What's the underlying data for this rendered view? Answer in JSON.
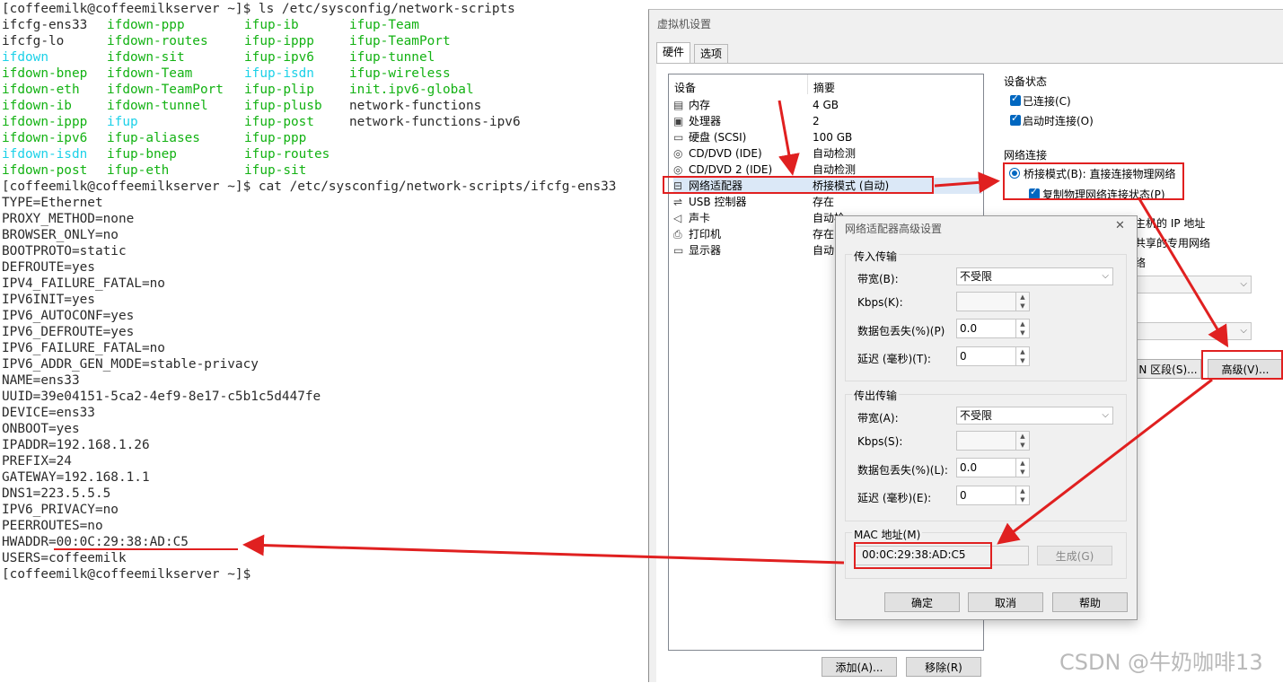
{
  "terminal": {
    "prompt1": "[coffeemilk@coffeemilkserver ~]$ ls /etc/sysconfig/network-scripts",
    "ls_rows": [
      [
        {
          "t": "ifcfg-ens33",
          "c": "norm"
        },
        {
          "t": "ifdown-ppp",
          "c": "green"
        },
        {
          "t": "ifup-ib",
          "c": "green"
        },
        {
          "t": "ifup-Team",
          "c": "green"
        }
      ],
      [
        {
          "t": "ifcfg-lo",
          "c": "norm"
        },
        {
          "t": "ifdown-routes",
          "c": "green"
        },
        {
          "t": "ifup-ippp",
          "c": "green"
        },
        {
          "t": "ifup-TeamPort",
          "c": "green"
        }
      ],
      [
        {
          "t": "ifdown",
          "c": "cyan"
        },
        {
          "t": "ifdown-sit",
          "c": "green"
        },
        {
          "t": "ifup-ipv6",
          "c": "green"
        },
        {
          "t": "ifup-tunnel",
          "c": "green"
        }
      ],
      [
        {
          "t": "ifdown-bnep",
          "c": "green"
        },
        {
          "t": "ifdown-Team",
          "c": "green"
        },
        {
          "t": "ifup-isdn",
          "c": "cyan"
        },
        {
          "t": "ifup-wireless",
          "c": "green"
        }
      ],
      [
        {
          "t": "ifdown-eth",
          "c": "green"
        },
        {
          "t": "ifdown-TeamPort",
          "c": "green"
        },
        {
          "t": "ifup-plip",
          "c": "green"
        },
        {
          "t": "init.ipv6-global",
          "c": "green"
        }
      ],
      [
        {
          "t": "ifdown-ib",
          "c": "green"
        },
        {
          "t": "ifdown-tunnel",
          "c": "green"
        },
        {
          "t": "ifup-plusb",
          "c": "green"
        },
        {
          "t": "network-functions",
          "c": "norm"
        }
      ],
      [
        {
          "t": "ifdown-ippp",
          "c": "green"
        },
        {
          "t": "ifup",
          "c": "cyan"
        },
        {
          "t": "ifup-post",
          "c": "green"
        },
        {
          "t": "network-functions-ipv6",
          "c": "norm"
        }
      ],
      [
        {
          "t": "ifdown-ipv6",
          "c": "green"
        },
        {
          "t": "ifup-aliases",
          "c": "green"
        },
        {
          "t": "ifup-ppp",
          "c": "green"
        },
        {
          "t": "",
          "c": "norm"
        }
      ],
      [
        {
          "t": "ifdown-isdn",
          "c": "cyan"
        },
        {
          "t": "ifup-bnep",
          "c": "green"
        },
        {
          "t": "ifup-routes",
          "c": "green"
        },
        {
          "t": "",
          "c": "norm"
        }
      ],
      [
        {
          "t": "ifdown-post",
          "c": "green"
        },
        {
          "t": "ifup-eth",
          "c": "green"
        },
        {
          "t": "ifup-sit",
          "c": "green"
        },
        {
          "t": "",
          "c": "norm"
        }
      ]
    ],
    "prompt2": "[coffeemilk@coffeemilkserver ~]$ cat /etc/sysconfig/network-scripts/ifcfg-ens33",
    "cfg_lines": [
      "TYPE=Ethernet",
      "PROXY_METHOD=none",
      "BROWSER_ONLY=no",
      "BOOTPROTO=static",
      "DEFROUTE=yes",
      "IPV4_FAILURE_FATAL=no",
      "IPV6INIT=yes",
      "IPV6_AUTOCONF=yes",
      "IPV6_DEFROUTE=yes",
      "IPV6_FAILURE_FATAL=no",
      "IPV6_ADDR_GEN_MODE=stable-privacy",
      "NAME=ens33",
      "UUID=39e04151-5ca2-4ef9-8e17-c5b1c5d447fe",
      "DEVICE=ens33",
      "ONBOOT=yes",
      "IPADDR=192.168.1.26",
      "PREFIX=24",
      "GATEWAY=192.168.1.1",
      "DNS1=223.5.5.5",
      "IPV6_PRIVACY=no",
      "PEERROUTES=no",
      "HWADDR=00:0C:29:38:AD:C5",
      "USERS=coffeemilk"
    ],
    "prompt3": "[coffeemilk@coffeemilkserver ~]$",
    "colors": {
      "green": "#13b213",
      "cyan": "#1cd1e8",
      "text": "#2b2b2b"
    }
  },
  "vm": {
    "title": "虚拟机设置",
    "tabs": [
      "硬件",
      "选项"
    ],
    "col_device": "设备",
    "col_summary": "摘要",
    "devices": [
      {
        "name": "内存",
        "summary": "4 GB",
        "icon": "memory-icon"
      },
      {
        "name": "处理器",
        "summary": "2",
        "icon": "cpu-icon"
      },
      {
        "name": "硬盘 (SCSI)",
        "summary": "100 GB",
        "icon": "harddisk-icon"
      },
      {
        "name": "CD/DVD (IDE)",
        "summary": "自动检测",
        "icon": "cdrom-icon"
      },
      {
        "name": "CD/DVD 2 (IDE)",
        "summary": "自动检测",
        "icon": "cdrom-icon"
      },
      {
        "name": "网络适配器",
        "summary": "桥接模式 (自动)",
        "icon": "network-adapter-icon"
      },
      {
        "name": "USB 控制器",
        "summary": "存在",
        "icon": "usb-icon"
      },
      {
        "name": "声卡",
        "summary": "自动检",
        "icon": "speaker-icon"
      },
      {
        "name": "打印机",
        "summary": "存在",
        "icon": "printer-icon"
      },
      {
        "name": "显示器",
        "summary": "自动",
        "icon": "monitor-icon"
      }
    ],
    "add_button": "添加(A)...",
    "remove_button": "移除(R)",
    "device_status": "设备状态",
    "connected": "已连接(C)",
    "connect_on_power": "启动时连接(O)",
    "net_conn": "网络连接",
    "bridged": "桥接模式(B): 直接连接物理网络",
    "replicate": "复制物理网络连接状态(P)",
    "partial_host_ip": "主机的 IP 地址",
    "partial_shared": "共享的专用网络",
    "partial_grid": "络",
    "lan_segment_btn": "N 区段(S)...",
    "advanced_btn": "高级(V)..."
  },
  "dialog": {
    "title": "网络适配器高级设置",
    "incoming": "传入传输",
    "outgoing": "传出传输",
    "bandwidth_in_label": "带宽(B):",
    "bandwidth_in_value": "不受限",
    "kbps_in_label": "Kbps(K):",
    "loss_in_label": "数据包丢失(%)(P)",
    "loss_in_value": "0.0",
    "delay_in_label": "延迟 (毫秒)(T):",
    "delay_in_value": "0",
    "bandwidth_out_label": "带宽(A):",
    "bandwidth_out_value": "不受限",
    "kbps_out_label": "Kbps(S):",
    "loss_out_label": "数据包丢失(%)(L):",
    "loss_out_value": "0.0",
    "delay_out_label": "延迟 (毫秒)(E):",
    "delay_out_value": "0",
    "mac_label": "MAC 地址(M)",
    "mac_value": "00:0C:29:38:AD:C5",
    "generate_btn": "生成(G)",
    "ok_btn": "确定",
    "cancel_btn": "取消",
    "help_btn": "帮助",
    "close_glyph": "✕"
  },
  "watermark": "CSDN @牛奶咖啡13",
  "annotation_color": "#e02020"
}
